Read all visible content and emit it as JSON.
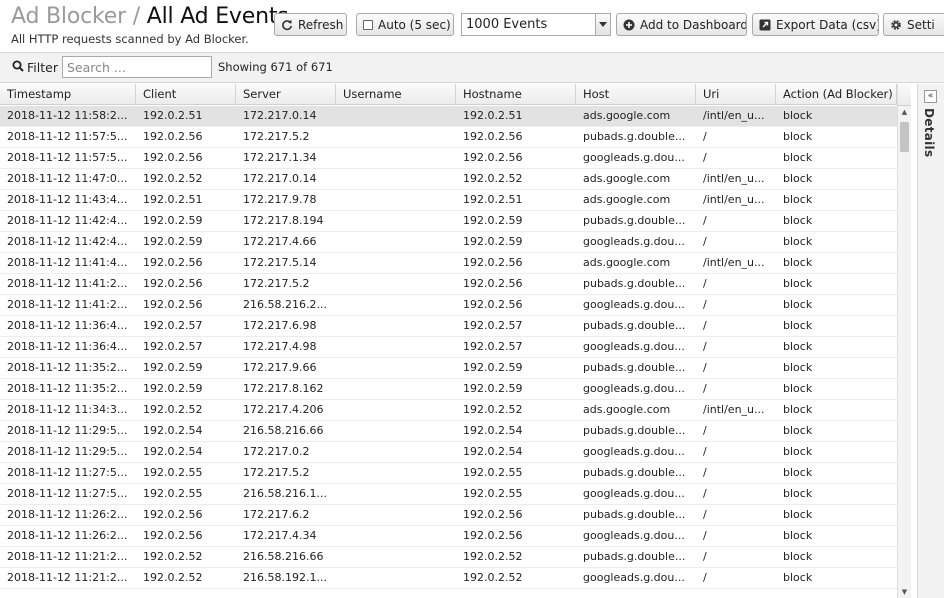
{
  "header": {
    "app_name": "Ad Blocker",
    "separator": "/",
    "page_title": "All Ad Events",
    "subtitle": "All HTTP requests scanned by Ad Blocker."
  },
  "toolbar": {
    "refresh_label": "Refresh",
    "auto_label": "Auto (5 sec)",
    "events_select_value": "1000 Events",
    "add_dashboard_label": "Add to Dashboard",
    "export_label": "Export Data (csv)",
    "settings_label": "Setti"
  },
  "filter": {
    "label": "Filter",
    "placeholder": "Search ...",
    "showing": "Showing 671 of 671"
  },
  "table": {
    "columns": [
      "Timestamp",
      "Client",
      "Server",
      "Username",
      "Hostname",
      "Host",
      "Uri",
      "Action (Ad Blocker)"
    ],
    "rows": [
      [
        "2018-11-12 11:58:2...",
        "192.0.2.51",
        "172.217.0.14",
        "",
        "192.0.2.51",
        "ads.google.com",
        "/intl/en_u...",
        "block"
      ],
      [
        "2018-11-12 11:57:5...",
        "192.0.2.56",
        "172.217.5.2",
        "",
        "192.0.2.56",
        "pubads.g.double...",
        "/",
        "block"
      ],
      [
        "2018-11-12 11:57:5...",
        "192.0.2.56",
        "172.217.1.34",
        "",
        "192.0.2.56",
        "googleads.g.dou...",
        "/",
        "block"
      ],
      [
        "2018-11-12 11:47:0...",
        "192.0.2.52",
        "172.217.0.14",
        "",
        "192.0.2.52",
        "ads.google.com",
        "/intl/en_u...",
        "block"
      ],
      [
        "2018-11-12 11:43:4...",
        "192.0.2.51",
        "172.217.9.78",
        "",
        "192.0.2.51",
        "ads.google.com",
        "/intl/en_u...",
        "block"
      ],
      [
        "2018-11-12 11:42:4...",
        "192.0.2.59",
        "172.217.8.194",
        "",
        "192.0.2.59",
        "pubads.g.double...",
        "/",
        "block"
      ],
      [
        "2018-11-12 11:42:4...",
        "192.0.2.59",
        "172.217.4.66",
        "",
        "192.0.2.59",
        "googleads.g.dou...",
        "/",
        "block"
      ],
      [
        "2018-11-12 11:41:4...",
        "192.0.2.56",
        "172.217.5.14",
        "",
        "192.0.2.56",
        "ads.google.com",
        "/intl/en_u...",
        "block"
      ],
      [
        "2018-11-12 11:41:2...",
        "192.0.2.56",
        "172.217.5.2",
        "",
        "192.0.2.56",
        "pubads.g.double...",
        "/",
        "block"
      ],
      [
        "2018-11-12 11:41:2...",
        "192.0.2.56",
        "216.58.216.2...",
        "",
        "192.0.2.56",
        "googleads.g.dou...",
        "/",
        "block"
      ],
      [
        "2018-11-12 11:36:4...",
        "192.0.2.57",
        "172.217.6.98",
        "",
        "192.0.2.57",
        "pubads.g.double...",
        "/",
        "block"
      ],
      [
        "2018-11-12 11:36:4...",
        "192.0.2.57",
        "172.217.4.98",
        "",
        "192.0.2.57",
        "googleads.g.dou...",
        "/",
        "block"
      ],
      [
        "2018-11-12 11:35:2...",
        "192.0.2.59",
        "172.217.9.66",
        "",
        "192.0.2.59",
        "pubads.g.double...",
        "/",
        "block"
      ],
      [
        "2018-11-12 11:35:2...",
        "192.0.2.59",
        "172.217.8.162",
        "",
        "192.0.2.59",
        "googleads.g.dou...",
        "/",
        "block"
      ],
      [
        "2018-11-12 11:34:3...",
        "192.0.2.52",
        "172.217.4.206",
        "",
        "192.0.2.52",
        "ads.google.com",
        "/intl/en_u...",
        "block"
      ],
      [
        "2018-11-12 11:29:5...",
        "192.0.2.54",
        "216.58.216.66",
        "",
        "192.0.2.54",
        "pubads.g.double...",
        "/",
        "block"
      ],
      [
        "2018-11-12 11:29:5...",
        "192.0.2.54",
        "172.217.0.2",
        "",
        "192.0.2.54",
        "googleads.g.dou...",
        "/",
        "block"
      ],
      [
        "2018-11-12 11:27:5...",
        "192.0.2.55",
        "172.217.5.2",
        "",
        "192.0.2.55",
        "pubads.g.double...",
        "/",
        "block"
      ],
      [
        "2018-11-12 11:27:5...",
        "192.0.2.55",
        "216.58.216.1...",
        "",
        "192.0.2.55",
        "googleads.g.dou...",
        "/",
        "block"
      ],
      [
        "2018-11-12 11:26:2...",
        "192.0.2.56",
        "172.217.6.2",
        "",
        "192.0.2.56",
        "pubads.g.double...",
        "/",
        "block"
      ],
      [
        "2018-11-12 11:26:2...",
        "192.0.2.56",
        "172.217.4.34",
        "",
        "192.0.2.56",
        "googleads.g.dou...",
        "/",
        "block"
      ],
      [
        "2018-11-12 11:21:2...",
        "192.0.2.52",
        "216.58.216.66",
        "",
        "192.0.2.52",
        "pubads.g.double...",
        "/",
        "block"
      ],
      [
        "2018-11-12 11:21:2...",
        "192.0.2.52",
        "216.58.192.1...",
        "",
        "192.0.2.52",
        "googleads.g.dou...",
        "/",
        "block"
      ]
    ],
    "selected_row": 0
  },
  "details_panel": {
    "label": "Details",
    "collapse_icon": "double-chevron-left-icon"
  },
  "colors": {
    "selected_row": "#e2e2e2",
    "header_gray": "#9a9a9a"
  }
}
